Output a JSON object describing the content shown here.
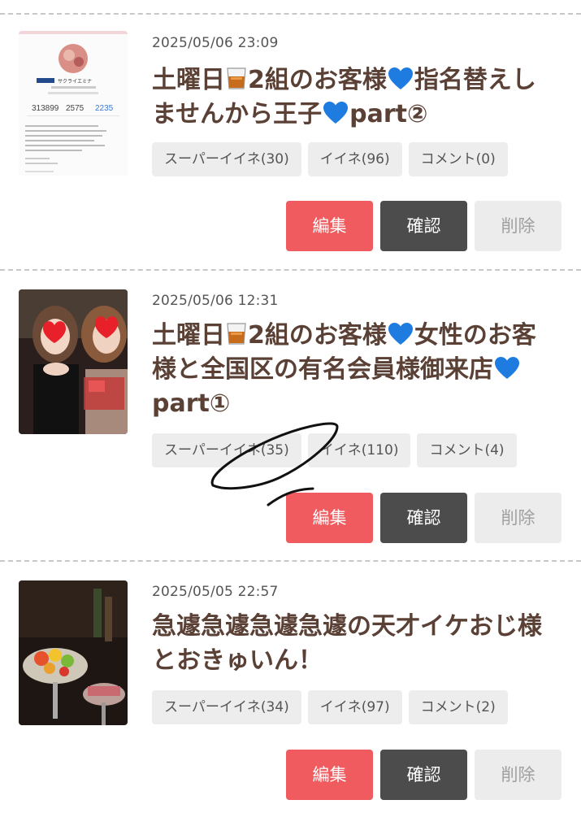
{
  "posts": [
    {
      "date": "2025/05/06 23:09",
      "title_parts": [
        "土曜日",
        "2組のお客様",
        "指名替えしませんから王子",
        "part②"
      ],
      "thumbnail": "profile-screenshot",
      "thumb_text": {
        "name": "サクライエミナ",
        "stats": [
          "313899",
          "2575",
          "2235"
        ]
      },
      "tags": [
        "スーパーイイネ(30)",
        "イイネ(96)",
        "コメント(0)"
      ],
      "buttons": {
        "edit": "編集",
        "confirm": "確認",
        "delete": "削除"
      }
    },
    {
      "date": "2025/05/06 12:31",
      "title_parts": [
        "土曜日",
        "2組のお客様",
        "女性のお客様と全国区の有名会員様御来店",
        "part①"
      ],
      "thumbnail": "two-women-photo",
      "tags": [
        "スーパーイイネ(35)",
        "イイネ(110)",
        "コメント(4)"
      ],
      "buttons": {
        "edit": "編集",
        "confirm": "確認",
        "delete": "削除"
      }
    },
    {
      "date": "2025/05/05 22:57",
      "title": "急遽急遽急遽急遽の天才イケおじ様とおきゅいん！",
      "thumbnail": "fruit-platter-photo",
      "tags": [
        "スーパーイイネ(34)",
        "イイネ(97)",
        "コメント(2)"
      ],
      "buttons": {
        "edit": "編集",
        "confirm": "確認",
        "delete": "削除"
      }
    }
  ],
  "colors": {
    "edit": "#ef5b5e",
    "confirm": "#4c4c4c",
    "delete": "#ececec",
    "title": "#5a4035",
    "heart": "#1e7be0"
  }
}
